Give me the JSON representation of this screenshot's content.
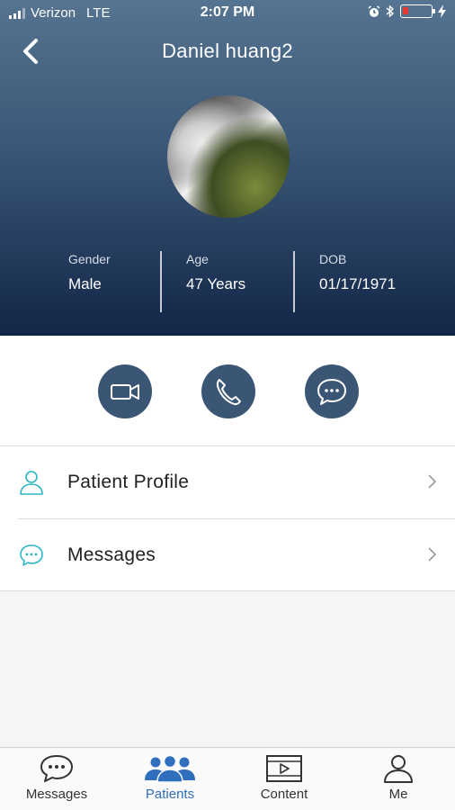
{
  "status_bar": {
    "carrier": "Verizon",
    "network": "LTE",
    "time": "2:07 PM"
  },
  "header": {
    "back_icon": "chevron-left-icon",
    "title": "Daniel huang2"
  },
  "patient_info": [
    {
      "key": "Gender",
      "value": "Male"
    },
    {
      "key": "Age",
      "value": "47 Years"
    },
    {
      "key": "DOB",
      "value": "01/17/1971"
    }
  ],
  "actions": [
    {
      "name": "video-call",
      "icon": "video-camera-icon"
    },
    {
      "name": "phone-call",
      "icon": "phone-icon"
    },
    {
      "name": "chat",
      "icon": "chat-bubble-icon"
    }
  ],
  "menu": [
    {
      "label": "Patient Profile",
      "icon": "person-icon"
    },
    {
      "label": "Messages",
      "icon": "chat-bubble-icon"
    }
  ],
  "tabs": [
    {
      "label": "Messages",
      "icon": "chat-bubble-icon",
      "active": false
    },
    {
      "label": "Patients",
      "icon": "group-icon",
      "active": true
    },
    {
      "label": "Content",
      "icon": "video-player-icon",
      "active": false
    },
    {
      "label": "Me",
      "icon": "person-icon",
      "active": false
    }
  ],
  "colors": {
    "header_top": "#557491",
    "header_bottom": "#122647",
    "action_button": "#3b5675",
    "accent_teal": "#2bb5c4",
    "tab_active": "#2f6fbd",
    "battery_low": "#e43a2f"
  }
}
